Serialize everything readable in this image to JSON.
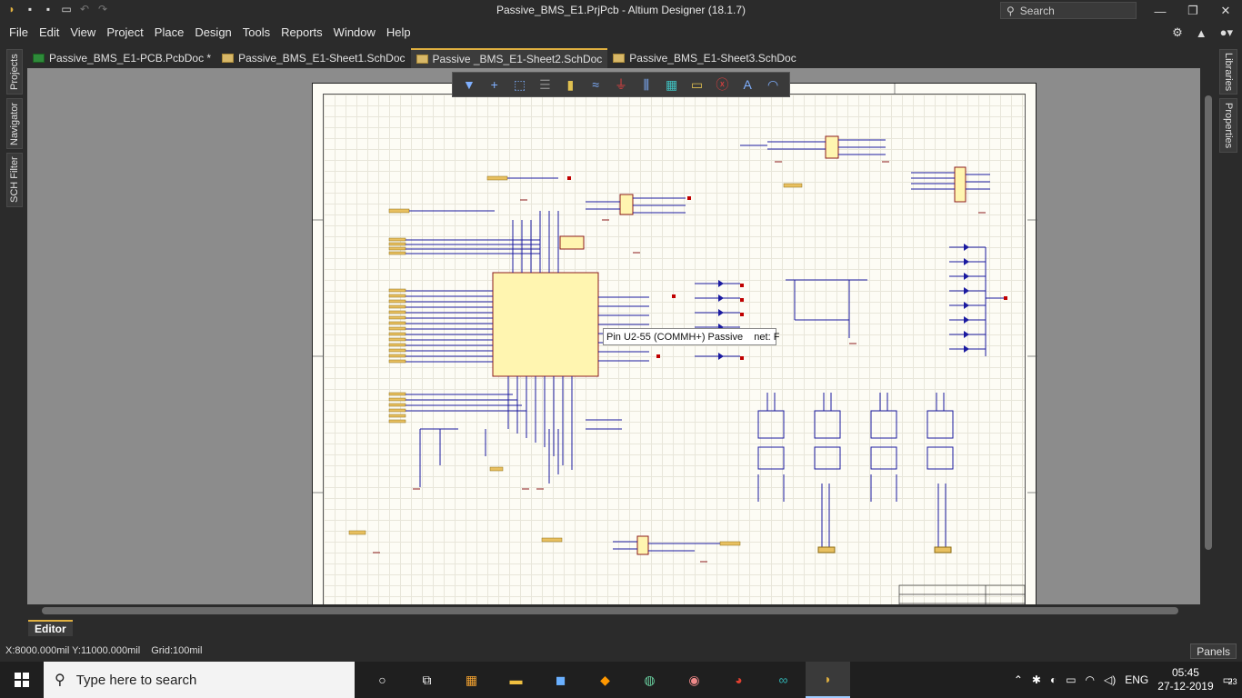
{
  "window": {
    "title": "Passive_BMS_E1.PrjPcb - Altium Designer (18.1.7)",
    "search_label": "Search",
    "minimize": "—",
    "maximize": "❐",
    "close": "✕"
  },
  "menu": {
    "items": [
      "File",
      "Edit",
      "View",
      "Project",
      "Place",
      "Design",
      "Tools",
      "Reports",
      "Window",
      "Help"
    ]
  },
  "tabs": [
    {
      "label": "Passive_BMS_E1-PCB.PcbDoc *",
      "icon": "pcb-doc-icon",
      "active": false
    },
    {
      "label": "Passive_BMS_E1-Sheet1.SchDoc",
      "icon": "sch-doc-icon",
      "active": false
    },
    {
      "label": "Passive _BMS_E1-Sheet2.SchDoc",
      "icon": "sch-doc-icon",
      "active": true
    },
    {
      "label": "Passive_BMS_E1-Sheet3.SchDoc",
      "icon": "sch-doc-icon",
      "active": false
    }
  ],
  "left_panels": [
    "Projects",
    "Navigator",
    "SCH Filter"
  ],
  "right_panels": [
    "Libraries",
    "Properties"
  ],
  "active_bar": {
    "tools": [
      "filter-icon",
      "crosshair-icon",
      "select-rect-icon",
      "align-icon",
      "place-part-icon",
      "wire-icon",
      "gnd-port-icon",
      "bus-icon",
      "harness-icon",
      "net-label-icon",
      "directive-icon",
      "text-icon",
      "arc-icon"
    ]
  },
  "tooltip": {
    "text": "Pin U2-55 (COMMH+) Passive    net: F"
  },
  "editor_tab": "Editor",
  "status": {
    "coords": "X:8000.000mil Y:11000.000mil",
    "grid": "Grid:100mil",
    "panels": "Panels"
  },
  "taskbar": {
    "search_placeholder": "Type here to search",
    "language": "ENG",
    "time": "05:45",
    "date": "27-12-2019",
    "notifications": "23"
  },
  "colors": {
    "accent_tab": "#e0b040",
    "sheet_bg": "#fdfcf5",
    "wire": "#1a1aa0",
    "component_fill": "#fff5b0",
    "power_red": "#c00000"
  }
}
